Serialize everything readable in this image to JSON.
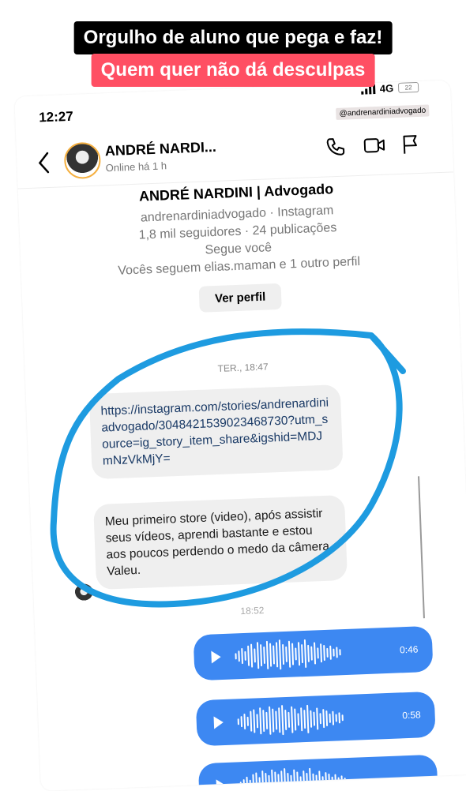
{
  "overlay": {
    "caption_1": "Orgulho de aluno que pega e faz!",
    "caption_2": "Quem quer não dá desculpas"
  },
  "status_bar": {
    "time": "12:27",
    "network": "4G",
    "battery": "22",
    "handle_tag": "@andrenardiniadvogado"
  },
  "header": {
    "name": "ANDRÉ NARDI...",
    "status": "Online há 1 h",
    "icons": [
      "back-icon",
      "phone-icon",
      "video-icon",
      "flag-icon"
    ]
  },
  "profile": {
    "full_name": "ANDRÉ NARDINI | Advogado",
    "username_line": "andrenardiniadvogado · Instagram",
    "stats_line": "1,8 mil seguidores · 24 publicações",
    "follows_you": "Segue você",
    "mutuals": "Vocês seguem elias.maman e 1 outro perfil",
    "view_profile_button": "Ver perfil"
  },
  "messages": {
    "timestamp_1": "TER., 18:47",
    "link_message": "https://instagram.com/stories/andrenardiniadvogado/3048421539023468730?utm_source=ig_story_item_share&igshid=MDJmNzVkMjY=",
    "text_message": "Meu primeiro store (video), após assistir seus vídeos, aprendi bastante e estou aos poucos perdendo o medo da câmera. Valeu.",
    "timestamp_2": "18:52",
    "audio": [
      {
        "duration": "0:46"
      },
      {
        "duration": "0:58"
      },
      {
        "duration": ""
      }
    ]
  },
  "colors": {
    "caption_1_bg": "#000000",
    "caption_2_bg": "#ff4f63",
    "annotation_circle": "#1e9be0",
    "audio_bubble": "#3d88f2"
  }
}
